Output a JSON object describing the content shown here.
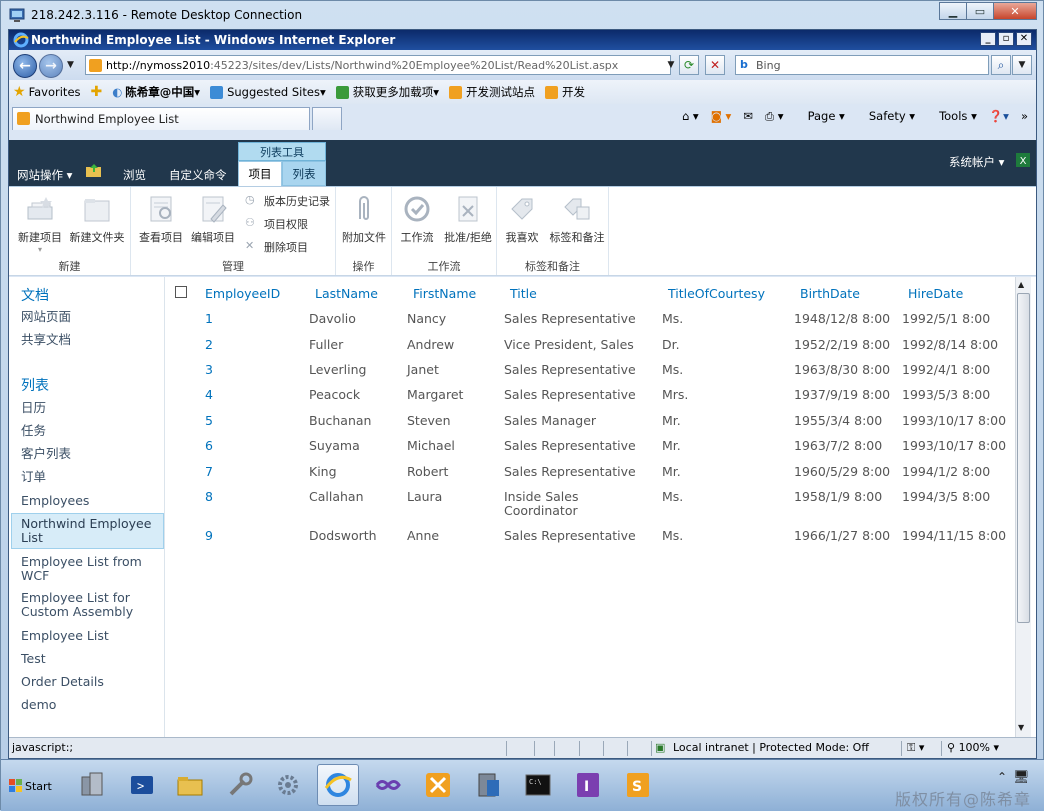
{
  "rdp": {
    "title": "218.242.3.116 - Remote Desktop Connection"
  },
  "ie": {
    "title": "Northwind Employee List - Windows Internet Explorer",
    "url_host": "http://nymoss2010",
    "url_rest": ":45223/sites/dev/Lists/Northwind%20Employee%20List/Read%20List.aspx",
    "search_placeholder": "Bing",
    "favorites": {
      "label": "Favorites",
      "items": [
        "陈希章@中国",
        "Suggested Sites",
        "获取更多加载项",
        "开发测试站点",
        "开发"
      ]
    },
    "tab_title": "Northwind Employee List",
    "commands": [
      "Page",
      "Safety",
      "Tools"
    ]
  },
  "sharepoint": {
    "site_actions": "网站操作",
    "menu_browse": "浏览",
    "menu_custom": "自定义命令",
    "ctx_group": "列表工具",
    "ctx_tab_items": "项目",
    "ctx_tab_list": "列表",
    "user": "系统帐户",
    "ribbon": {
      "groups": {
        "new": "新建",
        "manage": "管理",
        "actions": "操作",
        "workflow": "工作流",
        "tags": "标签和备注"
      },
      "buttons": {
        "new_item": "新建项目",
        "new_folder": "新建文件夹",
        "view_item": "查看项目",
        "edit_item": "编辑项目",
        "version_history": "版本历史记录",
        "item_permissions": "项目权限",
        "delete_item": "删除项目",
        "attach_file": "附加文件",
        "workflows": "工作流",
        "approve_reject": "批准/拒绝",
        "i_like_it": "我喜欢",
        "tags_notes": "标签和备注"
      }
    },
    "leftnav": {
      "docs_head": "文档",
      "docs": [
        "网站页面",
        "共享文档"
      ],
      "lists_head": "列表",
      "lists": [
        "日历",
        "任务",
        "客户列表",
        "订单",
        "Employees",
        "Northwind Employee List",
        "Employee List from WCF",
        "Employee List for Custom Assembly",
        "Employee List",
        "Test",
        "Order Details",
        "demo"
      ]
    },
    "grid": {
      "columns": [
        "EmployeeID",
        "LastName",
        "FirstName",
        "Title",
        "TitleOfCourtesy",
        "BirthDate",
        "HireDate"
      ],
      "rows": [
        [
          "1",
          "Davolio",
          "Nancy",
          "Sales Representative",
          "Ms.",
          "1948/12/8 8:00",
          "1992/5/1 8:00"
        ],
        [
          "2",
          "Fuller",
          "Andrew",
          "Vice President, Sales",
          "Dr.",
          "1952/2/19 8:00",
          "1992/8/14 8:00"
        ],
        [
          "3",
          "Leverling",
          "Janet",
          "Sales Representative",
          "Ms.",
          "1963/8/30 8:00",
          "1992/4/1 8:00"
        ],
        [
          "4",
          "Peacock",
          "Margaret",
          "Sales Representative",
          "Mrs.",
          "1937/9/19 8:00",
          "1993/5/3 8:00"
        ],
        [
          "5",
          "Buchanan",
          "Steven",
          "Sales Manager",
          "Mr.",
          "1955/3/4 8:00",
          "1993/10/17 8:00"
        ],
        [
          "6",
          "Suyama",
          "Michael",
          "Sales Representative",
          "Mr.",
          "1963/7/2 8:00",
          "1993/10/17 8:00"
        ],
        [
          "7",
          "King",
          "Robert",
          "Sales Representative",
          "Mr.",
          "1960/5/29 8:00",
          "1994/1/2 8:00"
        ],
        [
          "8",
          "Callahan",
          "Laura",
          "Inside Sales Coordinator",
          "Ms.",
          "1958/1/9 8:00",
          "1994/3/5 8:00"
        ],
        [
          "9",
          "Dodsworth",
          "Anne",
          "Sales Representative",
          "Ms.",
          "1966/1/27 8:00",
          "1994/11/15 8:00"
        ]
      ]
    }
  },
  "status": {
    "left": "javascript:;",
    "zone": "Local intranet | Protected Mode: Off",
    "zoom": "100%"
  },
  "taskbar": {
    "start": "Start",
    "watermark": "版权所有@陈希章"
  },
  "colors": {
    "sp_bar": "#21374c",
    "link": "#0072bc",
    "ctx_tab": "#b1dbf0"
  }
}
